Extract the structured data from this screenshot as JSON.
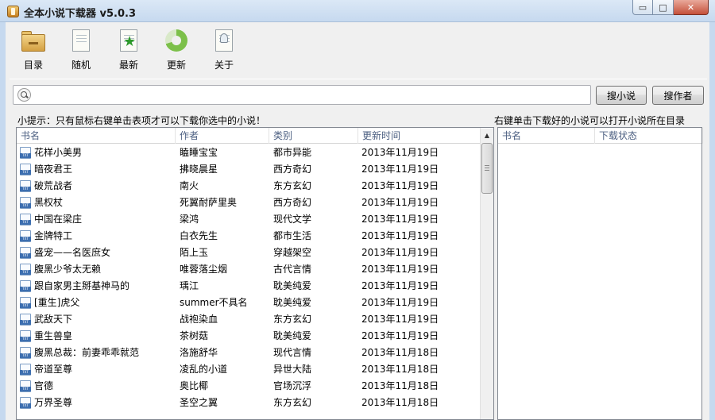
{
  "window": {
    "title": "全本小说下载器 v5.0.3",
    "min_glyph": "▭",
    "max_glyph": "□",
    "close_glyph": "✕"
  },
  "toolbar": {
    "items": [
      {
        "label": "目录",
        "icon": "folder-icon"
      },
      {
        "label": "随机",
        "icon": "document-icon"
      },
      {
        "label": "最新",
        "icon": "star-document-icon"
      },
      {
        "label": "更新",
        "icon": "refresh-ring-icon"
      },
      {
        "label": "关于",
        "icon": "about-document-icon"
      }
    ]
  },
  "search": {
    "value": "",
    "placeholder": "",
    "search_novel_label": "搜小说",
    "search_author_label": "搜作者"
  },
  "left_panel": {
    "hint": "小提示：只有鼠标右键单击表项才可以下载你选中的小说！",
    "columns": [
      "书名",
      "作者",
      "类别",
      "更新时间"
    ],
    "rows": [
      [
        "花样小美男",
        "瞌睡宝宝",
        "都市异能",
        "2013年11月19日"
      ],
      [
        "暗夜君王",
        "拂晓晨星",
        "西方奇幻",
        "2013年11月19日"
      ],
      [
        "破荒战者",
        "南火",
        "东方玄幻",
        "2013年11月19日"
      ],
      [
        "黑权杖",
        "死翼耐萨里奥",
        "西方奇幻",
        "2013年11月19日"
      ],
      [
        "中国在梁庄",
        "梁鸿",
        "现代文学",
        "2013年11月19日"
      ],
      [
        "金牌特工",
        "白衣先生",
        "都市生活",
        "2013年11月19日"
      ],
      [
        "盛宠——名医庶女",
        "陌上玉",
        "穿越架空",
        "2013年11月19日"
      ],
      [
        "腹黑少爷太无赖",
        "唯蓉落尘烟",
        "古代言情",
        "2013年11月19日"
      ],
      [
        "跟自家男主掰基神马的",
        "瑀江",
        "耽美纯爱",
        "2013年11月19日"
      ],
      [
        "[重生]虎父",
        "summer不具名",
        "耽美纯爱",
        "2013年11月19日"
      ],
      [
        "武敌天下",
        "战袍染血",
        "东方玄幻",
        "2013年11月19日"
      ],
      [
        "重生兽皇",
        "茶树菇",
        "耽美纯爱",
        "2013年11月19日"
      ],
      [
        "腹黑总裁：前妻乖乖就范",
        "洛施舒华",
        "现代言情",
        "2013年11月18日"
      ],
      [
        "帝道至尊",
        "凌乱的小道",
        "异世大陆",
        "2013年11月18日"
      ],
      [
        "官德",
        "奥比椰",
        "官场沉浮",
        "2013年11月18日"
      ],
      [
        "万界圣尊",
        "圣空之翼",
        "东方玄幻",
        "2013年11月18日"
      ]
    ]
  },
  "right_panel": {
    "hint": "右键单击下载好的小说可以打开小说所在目录",
    "columns": [
      "书名",
      "下载状态"
    ]
  }
}
